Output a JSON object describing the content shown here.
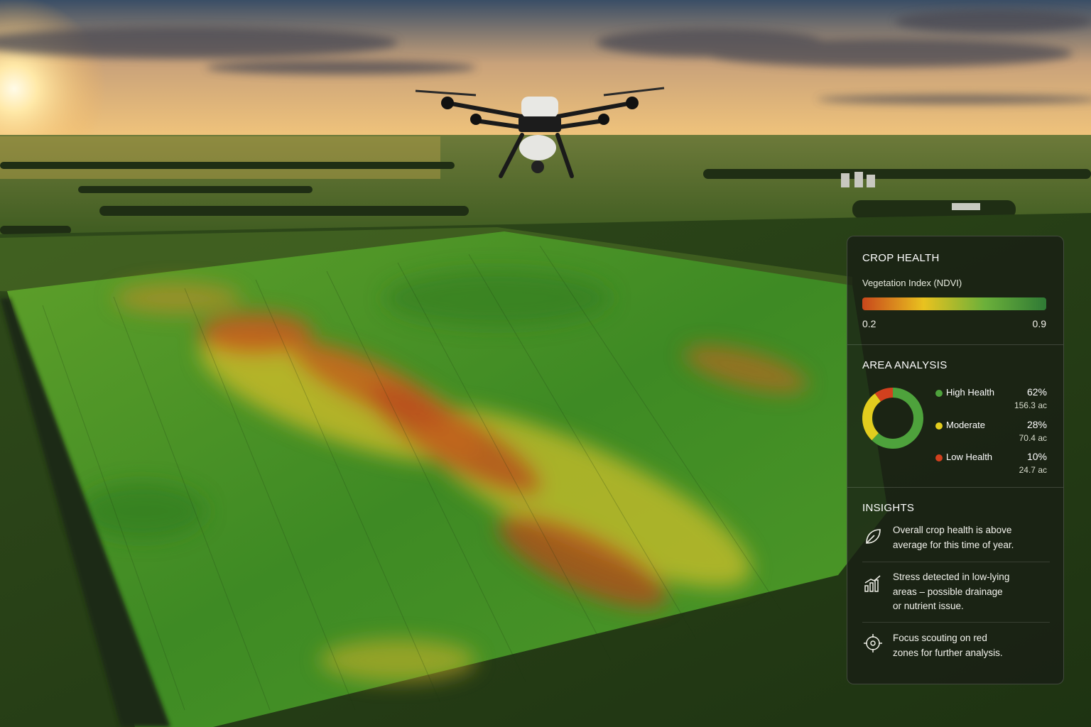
{
  "panel": {
    "crop_health": {
      "title": "CROP HEALTH",
      "index_label": "Vegetation Index (NDVI)",
      "scale_min": "0.2",
      "scale_max": "0.9",
      "gradient_colors": [
        "#c8471c",
        "#e9c21f",
        "#6bb03a",
        "#2f7a35"
      ]
    },
    "area_analysis": {
      "title": "AREA ANALYSIS",
      "items": [
        {
          "label": "High Health",
          "pct": "62%",
          "acres": "156.3 ac",
          "value": 62,
          "color": "#4ea23c"
        },
        {
          "label": "Moderate",
          "pct": "28%",
          "acres": "70.4 ac",
          "value": 28,
          "color": "#e3cd1e"
        },
        {
          "label": "Low Health",
          "pct": "10%",
          "acres": "24.7 ac",
          "value": 10,
          "color": "#d2401e"
        }
      ]
    },
    "insights": {
      "title": "INSIGHTS",
      "items": [
        {
          "icon": "leaf-icon",
          "lines": [
            "Overall crop health is above",
            "average for this time of year."
          ]
        },
        {
          "icon": "bar-chart-icon",
          "lines": [
            "Stress detected in low-lying",
            "areas – possible drainage",
            "or nutrient issue."
          ]
        },
        {
          "icon": "target-icon",
          "lines": [
            "Focus scouting on red",
            "zones for further analysis."
          ]
        }
      ]
    }
  }
}
